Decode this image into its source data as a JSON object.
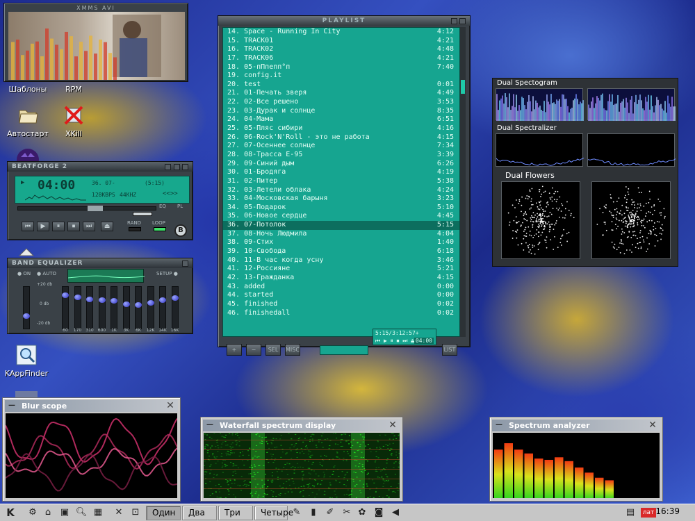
{
  "desktop": {
    "icons": [
      {
        "label": "Шаблоны"
      },
      {
        "label": "RPM"
      },
      {
        "label": "Автостарт"
      },
      {
        "label": "XKill"
      },
      {
        "label": "KAppFinder"
      }
    ],
    "video_window_title": "XMMS AVI"
  },
  "beatforge": {
    "title": "BEATFORGE 2",
    "time": "04:00",
    "song": "36. 07-",
    "song_length": "(5:15)",
    "bitrate": "128KBPS",
    "samplerate": "44KHZ",
    "eq_label": "EQ",
    "pl_label": "PL",
    "rand_label": "RAND",
    "loop_label": "LOOP",
    "transport": [
      "⏮",
      "▶",
      "⏸",
      "⏹",
      "⏭",
      "⏏"
    ]
  },
  "equalizer": {
    "title": "BAND EQUALIZER",
    "on_label": "ON",
    "auto_label": "AUTO",
    "setup_label": "SETUP",
    "db_labels": [
      "+20 db",
      "0 db",
      "-20 db"
    ],
    "bands": [
      {
        "freq": "60",
        "level": 0.85
      },
      {
        "freq": "170",
        "level": 0.8
      },
      {
        "freq": "310",
        "level": 0.75
      },
      {
        "freq": "600",
        "level": 0.72
      },
      {
        "freq": "1K",
        "level": 0.7
      },
      {
        "freq": "3K",
        "level": 0.62
      },
      {
        "freq": "6K",
        "level": 0.6
      },
      {
        "freq": "12K",
        "level": 0.64
      },
      {
        "freq": "14K",
        "level": 0.72
      },
      {
        "freq": "16K",
        "level": 0.78
      }
    ],
    "preamp_level": 0.3
  },
  "playlist": {
    "title": "PLAYLIST",
    "selected_index": 22,
    "tracks": [
      {
        "title": "14. Space - Running In City",
        "time": "4:12"
      },
      {
        "title": "15. TRACK01",
        "time": "4:21"
      },
      {
        "title": "16. TRACK02",
        "time": "4:48"
      },
      {
        "title": "17. TRACK06",
        "time": "4:21"
      },
      {
        "title": "18. 05-пПпепп°п",
        "time": "7:40"
      },
      {
        "title": "19. config.it",
        "time": ""
      },
      {
        "title": "20. test",
        "time": "0:01"
      },
      {
        "title": "21. 01-Печать зверя",
        "time": "4:49"
      },
      {
        "title": "22. 02-Все решено",
        "time": "3:53"
      },
      {
        "title": "23. 03-Дурак и солнце",
        "time": "8:35"
      },
      {
        "title": "24. 04-Мама",
        "time": "6:51"
      },
      {
        "title": "25. 05-Пляс сибири",
        "time": "4:16"
      },
      {
        "title": "26. 06-Rock'N'Roll - это не работа",
        "time": "4:15"
      },
      {
        "title": "27. 07-Осеннее солнце",
        "time": "7:34"
      },
      {
        "title": "28. 08-Трасса Е-95",
        "time": "3:39"
      },
      {
        "title": "29. 09-Синий дым",
        "time": "6:26"
      },
      {
        "title": "30. 01-Бродяга",
        "time": "4:19"
      },
      {
        "title": "31. 02-Питер",
        "time": "5:38"
      },
      {
        "title": "32. 03-Летели облака",
        "time": "4:24"
      },
      {
        "title": "33. 04-Московская барыня",
        "time": "3:23"
      },
      {
        "title": "34. 05-Подарок",
        "time": "5:10"
      },
      {
        "title": "35. 06-Новое сердце",
        "time": "4:45"
      },
      {
        "title": "36. 07-Потолок",
        "time": "5:15"
      },
      {
        "title": "37. 08-Ночь Людмила",
        "time": "4:04"
      },
      {
        "title": "38. 09-Стих",
        "time": "1:40"
      },
      {
        "title": "39. 10-Свобода",
        "time": "6:18"
      },
      {
        "title": "40. 11-В час когда усну",
        "time": "3:46"
      },
      {
        "title": "41. 12-Россияне",
        "time": "5:21"
      },
      {
        "title": "42. 13-Гражданка",
        "time": "4:15"
      },
      {
        "title": "43. added",
        "time": "0:00"
      },
      {
        "title": "44. started",
        "time": "0:00"
      },
      {
        "title": "45. finished",
        "time": "0:02"
      },
      {
        "title": "46. finishedall",
        "time": "0:02"
      }
    ],
    "buttons": [
      "+",
      "−",
      "SEL",
      "MISC",
      "LIST"
    ],
    "mini_info": "5:15/3:12:57+",
    "mini_time": "04:00"
  },
  "dual": {
    "spectogram_title": "Dual Spectogram",
    "spectralizer_title": "Dual Spectralizer",
    "flowers_title": "Dual Flowers"
  },
  "plugins": {
    "blur_scope": {
      "title": "Blur scope"
    },
    "waterfall": {
      "title": "Waterfall spectrum display"
    },
    "spectrum": {
      "title": "Spectrum analyzer",
      "bars": [
        0.78,
        0.88,
        0.78,
        0.72,
        0.64,
        0.62,
        0.66,
        0.6,
        0.5,
        0.42,
        0.34,
        0.3
      ]
    }
  },
  "taskbar": {
    "desktops": [
      "Один",
      "Два",
      "Три",
      "Четыре"
    ],
    "active_desktop": 0,
    "language": "лат",
    "clock": "16:39"
  },
  "colors": {
    "playlist_bg": "#16a590",
    "playlist_text": "#e6fff6",
    "playlist_selected": "#0c6e5e",
    "skin_dark": "#3a4147",
    "taskbar": "#c6c6c6"
  }
}
